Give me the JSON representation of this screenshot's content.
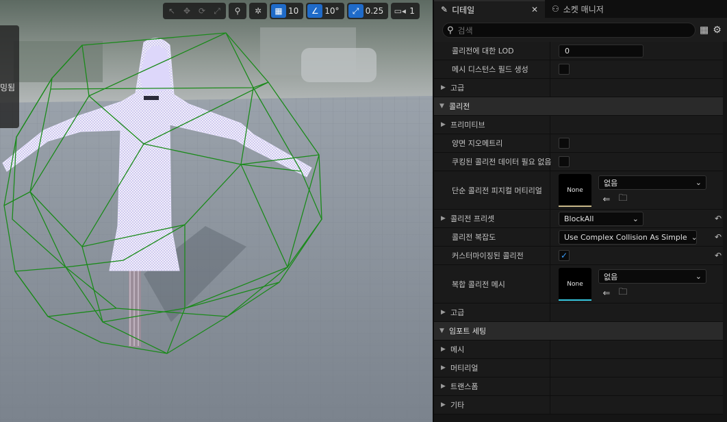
{
  "viewport": {
    "toolbar": {
      "grid_snap_value": "10",
      "rotation_snap_value": "10°",
      "scale_snap_value": "0.25",
      "camera_speed_value": "1"
    },
    "side_tab_label": "밍됨",
    "colors": {
      "mesh": "#d8d2f4",
      "collision_hull": "#1a8a1a",
      "floor": "#8a929b"
    }
  },
  "panel": {
    "tabs": [
      {
        "label": "디테일",
        "icon": "pencil-icon",
        "active": true
      },
      {
        "label": "소켓 매니저",
        "icon": "socket-icon",
        "active": false
      }
    ],
    "search_placeholder": "검색",
    "rows": {
      "lod_label": "콜리전에 대한 LOD",
      "lod_value": "0",
      "distance_field_label": "메시 디스턴스 필드 생성",
      "advanced1_label": "고급",
      "collision_category": "콜리전",
      "primitive_label": "프리미티브",
      "double_sided_label": "양면 지오메트리",
      "cooked_label": "쿠킹된 콜리전 데이터 필요 없음",
      "simple_material_label": "단순 콜리전 피지컬 머티리얼",
      "simple_material_thumb": "None",
      "simple_material_value": "없음",
      "preset_label": "콜리전 프리셋",
      "preset_value": "BlockAll",
      "complexity_label": "콜리전 복잡도",
      "complexity_value": "Use Complex Collision As Simple",
      "customized_label": "커스터마이징된 콜리전",
      "complex_mesh_label": "복합 콜리전 메시",
      "complex_mesh_thumb": "None",
      "complex_mesh_value": "없음",
      "advanced2_label": "고급",
      "import_category": "임포트 세팅",
      "mesh_label": "메시",
      "material_label": "머티리얼",
      "transform_label": "트랜스폼",
      "misc_label": "기타"
    },
    "colors": {
      "accent": "#1f6bc9",
      "check": "#3aa0ff",
      "material_bar": "#c9b98a",
      "mesh_bar": "#36c8e0"
    }
  }
}
